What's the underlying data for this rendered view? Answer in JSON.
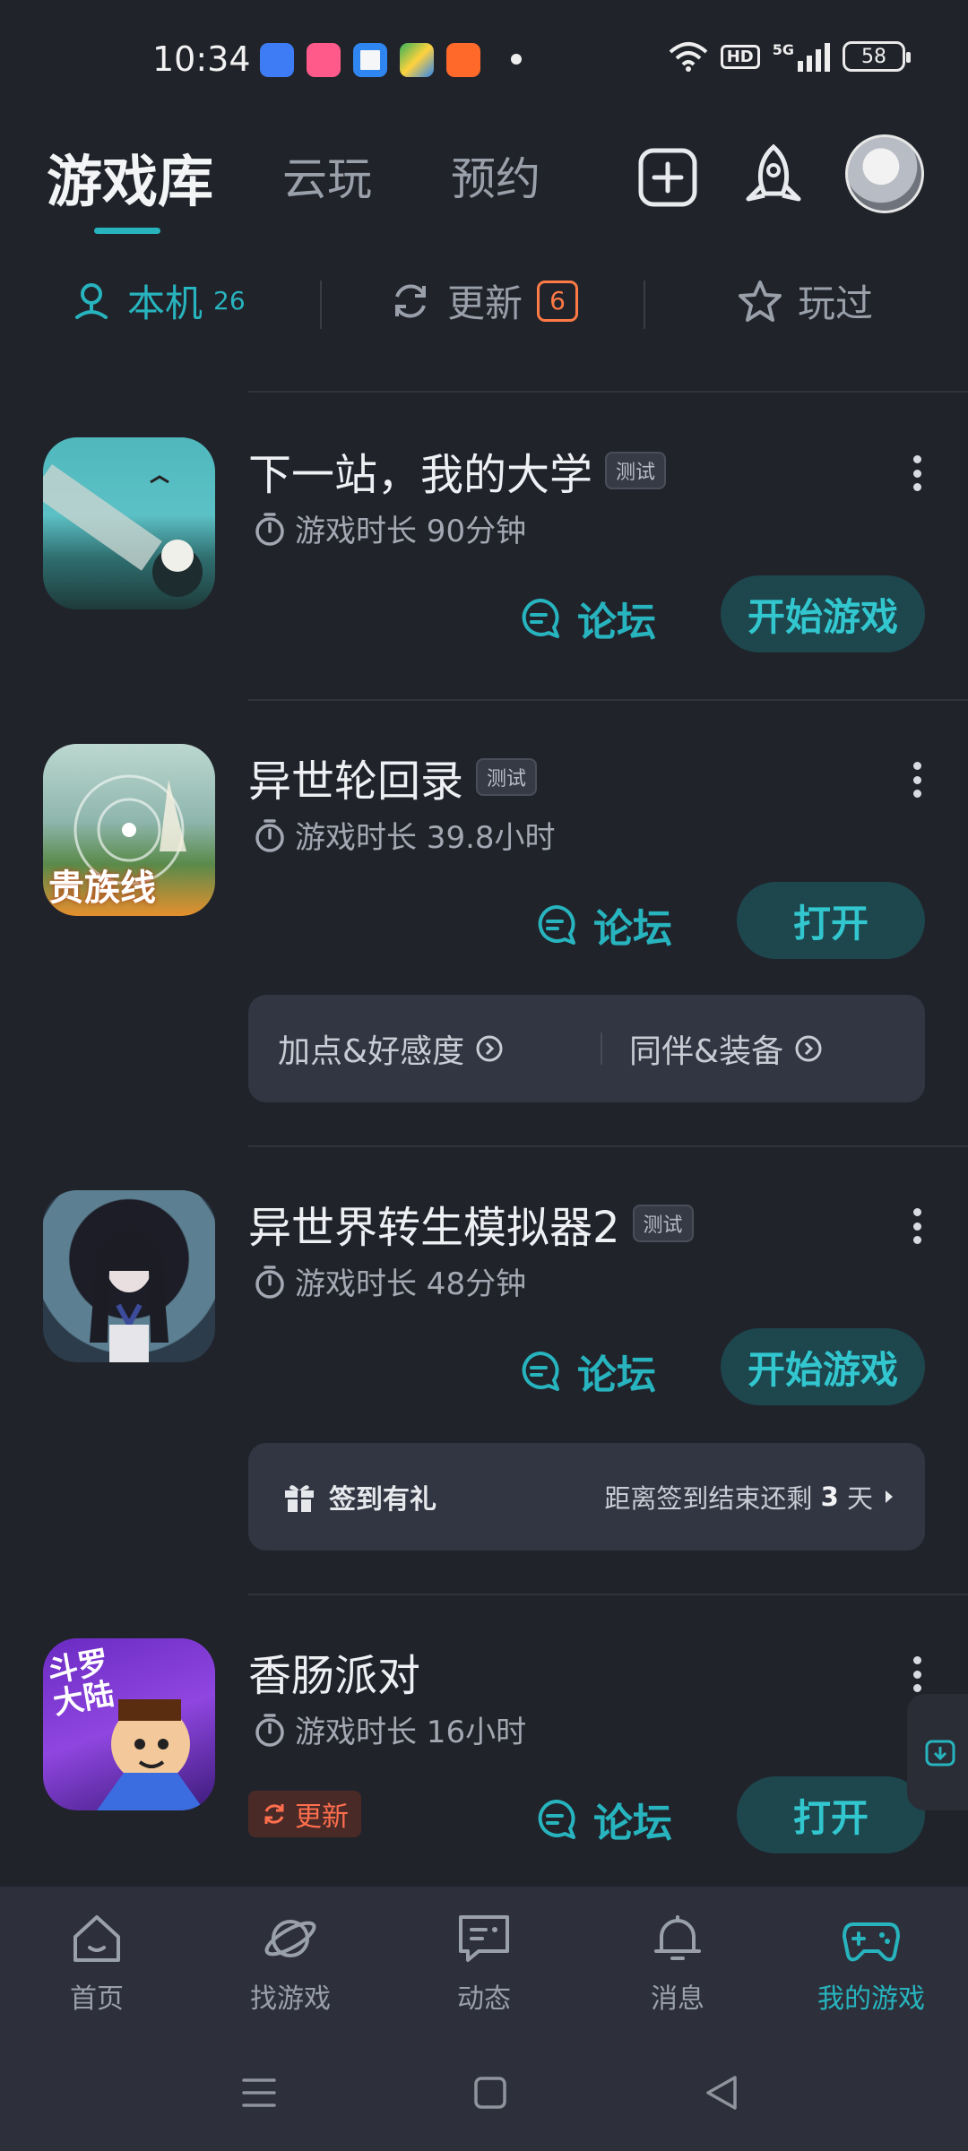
{
  "status_bar": {
    "time": "10:34",
    "network": "5G",
    "hd": "HD",
    "battery": "58",
    "app_icons": [
      "#3d7cf5",
      "#ff5a8a",
      "#2f86f0",
      "#34b15a",
      "#ff6a2b"
    ]
  },
  "header": {
    "tabs": [
      "游戏库",
      "云玩",
      "预约"
    ]
  },
  "filters": {
    "local_label": "本机",
    "local_count": "26",
    "update_label": "更新",
    "update_count": "6",
    "played_label": "玩过"
  },
  "games": [
    {
      "title": "下一站，我的大学",
      "tag": "测试",
      "playtime": "游戏时长 90分钟",
      "forum": "论坛",
      "action": "开始游戏"
    },
    {
      "title": "异世轮回录",
      "tag": "测试",
      "playtime": "游戏时长 39.8小时",
      "forum": "论坛",
      "action": "打开",
      "icon_text": "贵族线",
      "links": [
        "加点&好感度",
        "同伴&装备"
      ]
    },
    {
      "title": "异世界转生模拟器2",
      "tag": "测试",
      "playtime": "游戏时长 48分钟",
      "forum": "论坛",
      "action": "开始游戏",
      "signin_label": "签到有礼",
      "signin_prefix": "距离签到结束还剩 ",
      "signin_days": "3",
      "signin_suffix": " 天"
    },
    {
      "title": "香肠派对",
      "playtime": "游戏时长 16小时",
      "forum": "论坛",
      "action": "打开",
      "update_chip": "更新",
      "icon_text": "斗罗大陆"
    }
  ],
  "bottom_nav": [
    "首页",
    "找游戏",
    "动态",
    "消息",
    "我的游戏"
  ],
  "colors": {
    "accent": "#27b4be",
    "background": "#21232b",
    "update": "#ff7a45"
  }
}
